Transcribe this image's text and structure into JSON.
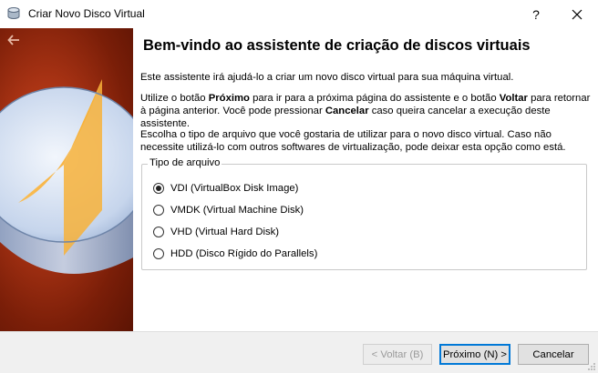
{
  "window": {
    "title": "Criar Novo Disco Virtual",
    "help_label": "?",
    "app_icon": "virtualbox-disk-icon",
    "close_icon": "close-icon"
  },
  "banner": {
    "back_icon": "back-arrow-icon",
    "colors": {
      "background": "#a93314",
      "disk_top": "#d6e4f7",
      "slice": "#f7b23a"
    }
  },
  "main": {
    "heading": "Bem-vindo ao assistente de criação de discos virtuais",
    "paragraph1": "Este assistente irá ajudá-lo a criar um novo disco virtual para sua máquina virtual.",
    "paragraph2": {
      "t1": "Utilize o botão ",
      "b1": "Próximo",
      "t2": " para ir para a próxima página do assistente e o botão ",
      "b2": "Voltar",
      "t3": " para retornar à página anterior. Você pode pressionar ",
      "b3": "Cancelar",
      "t4": " caso queira cancelar a execução deste assistente."
    },
    "paragraph3": "Escolha o tipo de arquivo que você gostaria de utilizar para o novo disco virtual. Caso não necessite utilizá-lo com outros softwares de virtualização, pode deixar esta opção como está.",
    "file_type": {
      "legend": "Tipo de arquivo",
      "options": [
        {
          "label": "VDI (VirtualBox Disk Image)",
          "checked": true
        },
        {
          "label": "VMDK (Virtual Machine Disk)",
          "checked": false
        },
        {
          "label": "VHD (Virtual Hard Disk)",
          "checked": false
        },
        {
          "label": "HDD (Disco Rígido do Parallels)",
          "checked": false
        }
      ]
    }
  },
  "footer": {
    "back_label": "< Voltar (B)",
    "next_label": "Próximo (N) >",
    "cancel_label": "Cancelar"
  }
}
